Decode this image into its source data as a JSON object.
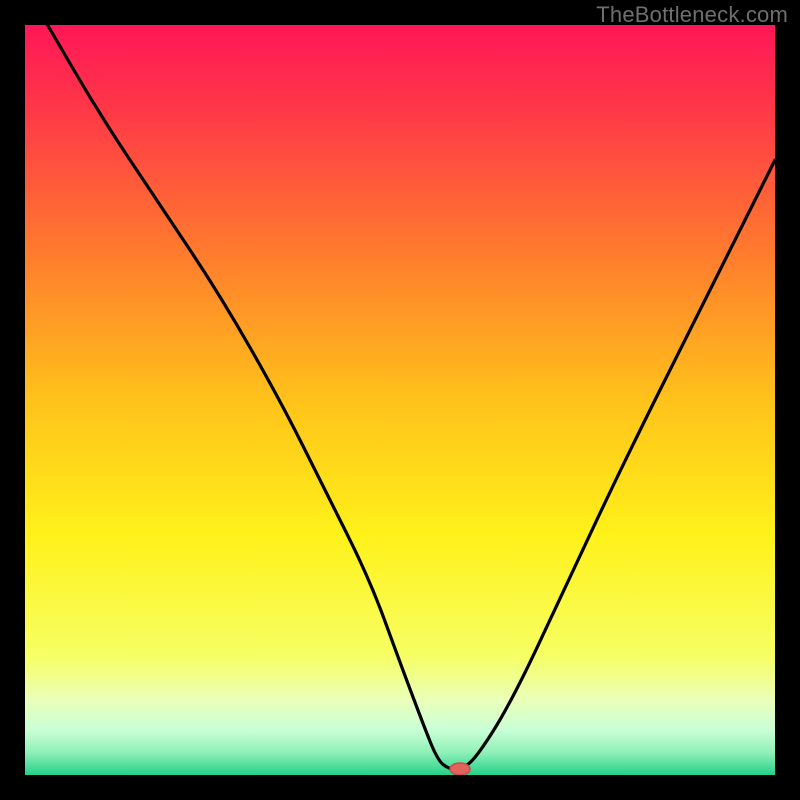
{
  "watermark": "TheBottleneck.com",
  "colors": {
    "frame": "#000000",
    "watermark": "#6f6f6f",
    "curve": "#000000",
    "marker_fill": "#e0645b",
    "marker_stroke": "#c94c45",
    "gradient_stops": [
      {
        "offset": 0.0,
        "color": "#ff1757"
      },
      {
        "offset": 0.12,
        "color": "#ff3a47"
      },
      {
        "offset": 0.3,
        "color": "#ff7a2e"
      },
      {
        "offset": 0.5,
        "color": "#ffc21a"
      },
      {
        "offset": 0.68,
        "color": "#fff11a"
      },
      {
        "offset": 0.84,
        "color": "#f6ff63"
      },
      {
        "offset": 0.9,
        "color": "#eaffb8"
      },
      {
        "offset": 0.94,
        "color": "#c9ffd6"
      },
      {
        "offset": 0.97,
        "color": "#8ff0b7"
      },
      {
        "offset": 1.0,
        "color": "#25d08a"
      }
    ]
  },
  "chart_data": {
    "type": "line",
    "title": "",
    "xlabel": "",
    "ylabel": "",
    "xlim": [
      0,
      100
    ],
    "ylim": [
      0,
      100
    ],
    "x": [
      3,
      10,
      18,
      26,
      34,
      40,
      46,
      50,
      53,
      55,
      56.5,
      58,
      60,
      65,
      72,
      80,
      90,
      100
    ],
    "values": [
      100,
      88,
      76,
      64,
      50,
      38,
      26,
      15,
      7,
      2,
      0.8,
      0.8,
      2,
      10,
      25,
      42,
      62,
      82
    ],
    "marker": {
      "x": 58,
      "y": 0.8
    }
  }
}
